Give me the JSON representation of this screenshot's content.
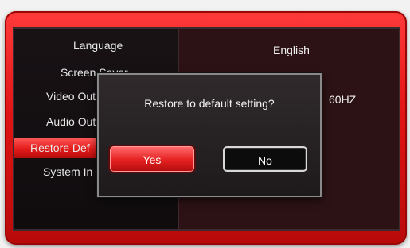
{
  "menu": {
    "items": [
      {
        "label": "Language"
      },
      {
        "label": "Screen Saver"
      },
      {
        "label": "Video Out"
      },
      {
        "label": "Audio Out"
      },
      {
        "label": "Restore Def"
      },
      {
        "label": "System In"
      }
    ],
    "selected_index": 4
  },
  "values": {
    "language": "English",
    "screen_saver": "Off",
    "video_out_suffix": "60HZ"
  },
  "dialog": {
    "message": "Restore to default setting?",
    "yes_label": "Yes",
    "no_label": "No"
  },
  "colors": {
    "bezel": "#e01414",
    "selection": "#e51b1b",
    "screen": "#1c1416"
  }
}
